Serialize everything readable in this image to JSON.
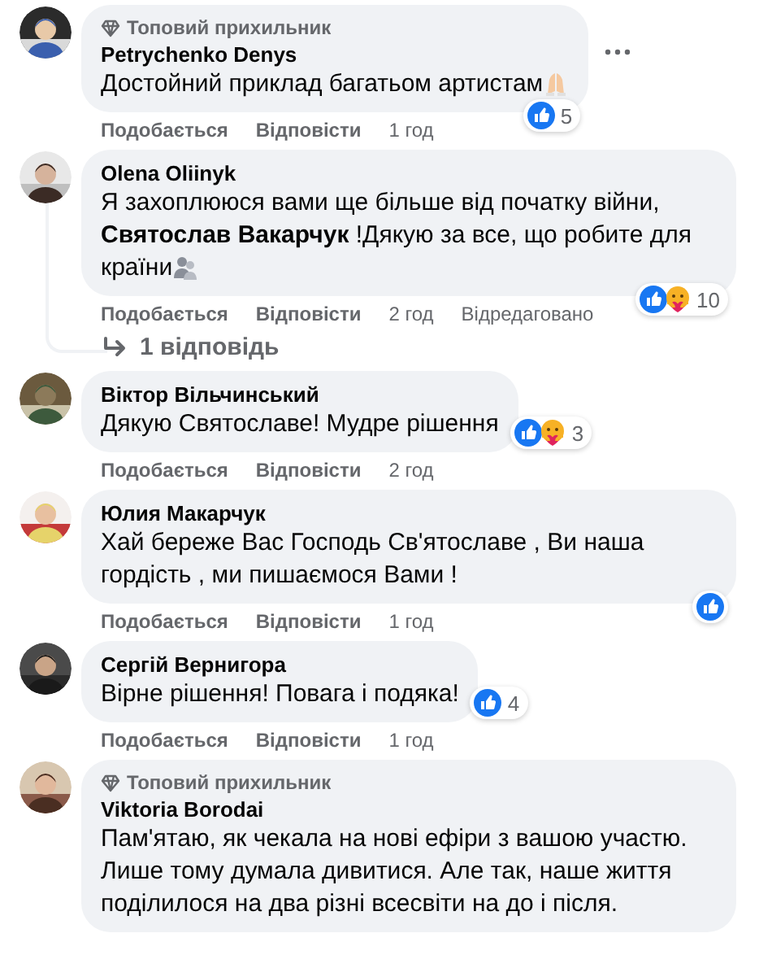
{
  "comments": [
    {
      "badge": "Топовий прихильник",
      "author": "Petrychenko Denys",
      "text": "Достойний приклад багатьом артистам",
      "emoji": true,
      "menu": true,
      "reactions": {
        "like": true,
        "count": "5"
      },
      "actions": {
        "like": "Подобається",
        "reply": "Відповісти",
        "time": "1 год"
      }
    },
    {
      "author": "Olena Oliinyk",
      "text": "Я захоплююся вами ще більше від початку війни, **Святослав Вакарчук** !Дякую за все, що робите для країни",
      "emoji": true,
      "reactions": {
        "like": true,
        "care": true,
        "count": "10"
      },
      "actions": {
        "like": "Подобається",
        "reply": "Відповісти",
        "time": "2 год",
        "edited": "Відредаговано"
      },
      "replies": "1 відповідь"
    },
    {
      "author": "Віктор Вільчинський",
      "text": "Дякую Святославе! Мудре рішення",
      "reactions": {
        "like": true,
        "care": true,
        "count": "3"
      },
      "actions": {
        "like": "Подобається",
        "reply": "Відповісти",
        "time": "2 год"
      }
    },
    {
      "author": "Юлия Макарчук",
      "text": "Хай береже Вас Господь Св'ятославе , Ви наша гордість , ми пишаємося Вами !",
      "reactions": {
        "like": true
      },
      "actions": {
        "like": "Подобається",
        "reply": "Відповісти",
        "time": "1 год"
      }
    },
    {
      "author": "Сергій Вернигора",
      "text": "Вірне рішення! Повага і подяка!",
      "reactions": {
        "like": true,
        "count": "4"
      },
      "actions": {
        "like": "Подобається",
        "reply": "Відповісти",
        "time": "1 год"
      }
    },
    {
      "badge": "Топовий прихильник",
      "author": "Viktoria Borodai",
      "text": "Пам'ятаю, як чекала на нові ефіри з вашою участю. Лише тому думала дивитися. Але так, наше життя поділилося на два різні всесвіти на до і після."
    }
  ]
}
